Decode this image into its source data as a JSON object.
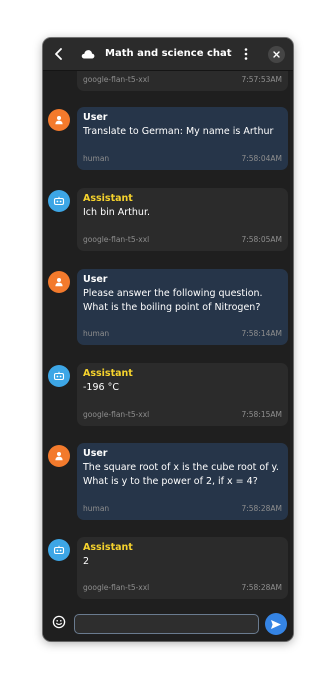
{
  "window": {
    "title": "Math and science chat"
  },
  "messages": [
    {
      "role": "assistant",
      "model": "google-flan-t5-xxl",
      "time": "7:57:53AM"
    },
    {
      "role": "user",
      "sender": "User",
      "text": "Translate to German:  My name is Arthur",
      "source": "human",
      "time": "7:58:04AM"
    },
    {
      "role": "assistant",
      "sender": "Assistant",
      "text": "Ich bin Arthur.",
      "model": "google-flan-t5-xxl",
      "time": "7:58:05AM"
    },
    {
      "role": "user",
      "sender": "User",
      "text": "Please answer the following question. What is the boiling point of Nitrogen?",
      "source": "human",
      "time": "7:58:14AM"
    },
    {
      "role": "assistant",
      "sender": "Assistant",
      "text": "-196 °C",
      "model": "google-flan-t5-xxl",
      "time": "7:58:15AM"
    },
    {
      "role": "user",
      "sender": "User",
      "text": "The square root of x is the cube root of y. What is y to the power of 2, if x = 4?",
      "source": "human",
      "time": "7:58:28AM"
    },
    {
      "role": "assistant",
      "sender": "Assistant",
      "text": "2",
      "model": "google-flan-t5-xxl",
      "time": "7:58:28AM"
    }
  ],
  "composer": {
    "value": "",
    "placeholder": ""
  },
  "icons": {
    "back": "chevron-left-icon",
    "provider": "cloud-icon",
    "menu": "kebab-menu-icon",
    "close": "close-icon",
    "user_avatar": "person-icon",
    "assistant_avatar": "robot-icon",
    "emoji": "emoji-icon",
    "send": "send-icon"
  },
  "colors": {
    "window_bg": "#1f1f1f",
    "user_bubble": "#263549",
    "assistant_bubble": "#2b2b2b",
    "user_avatar": "#f37a2c",
    "assistant_avatar": "#3da6e6",
    "assistant_name": "#f6d32d",
    "send_button": "#3584e4"
  }
}
